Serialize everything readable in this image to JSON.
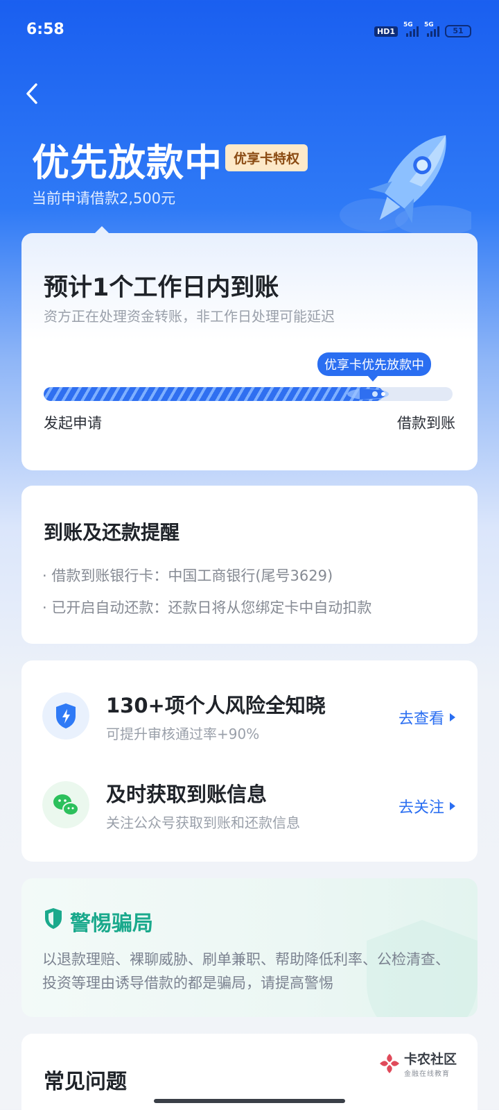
{
  "status_bar": {
    "time": "6:58",
    "hd_label": "HD1",
    "network_1": "5G",
    "network_2": "5G",
    "battery": "51"
  },
  "header": {
    "title": "优先放款中",
    "tag": "优享卡特权",
    "subtitle": "当前申请借款2,500元"
  },
  "progress_card": {
    "title": "预计1个工作日内到账",
    "subtitle": "资方正在处理资金转账，非工作日处理可能延迟",
    "tooltip": "优享卡优先放款中",
    "progress": 0.83,
    "start_label": "发起申请",
    "end_label": "借款到账"
  },
  "reminder_card": {
    "title": "到账及还款提醒",
    "items": [
      "· 借款到账银行卡：中国工商银行(尾号3629)",
      "· 已开启自动还款：还款日将从您绑定卡中自动扣款"
    ]
  },
  "services_card": {
    "items": [
      {
        "icon": "shield-lightning-icon",
        "title": "130+项个人风险全知晓",
        "subtitle": "可提升审核通过率+90%",
        "action": "去查看"
      },
      {
        "icon": "wechat-icon",
        "title": "及时获取到账信息",
        "subtitle": "关注公众号获取到账和还款信息",
        "action": "去关注"
      }
    ]
  },
  "fraud_card": {
    "title": "警惕骗局",
    "text": "以退款理赔、裸聊威胁、刷单兼职、帮助降低利率、公检清查、投资等理由诱导借款的都是骗局，请提高警惕"
  },
  "faq_card": {
    "title": "常见问题"
  },
  "watermark": {
    "main": "卡农社区",
    "sub": "金融在线教育"
  },
  "colors": {
    "primary": "#2a6ef1",
    "fraud_green": "#1aa98c",
    "tag_bg": "#fde9c9",
    "tag_text": "#8a4a12"
  }
}
